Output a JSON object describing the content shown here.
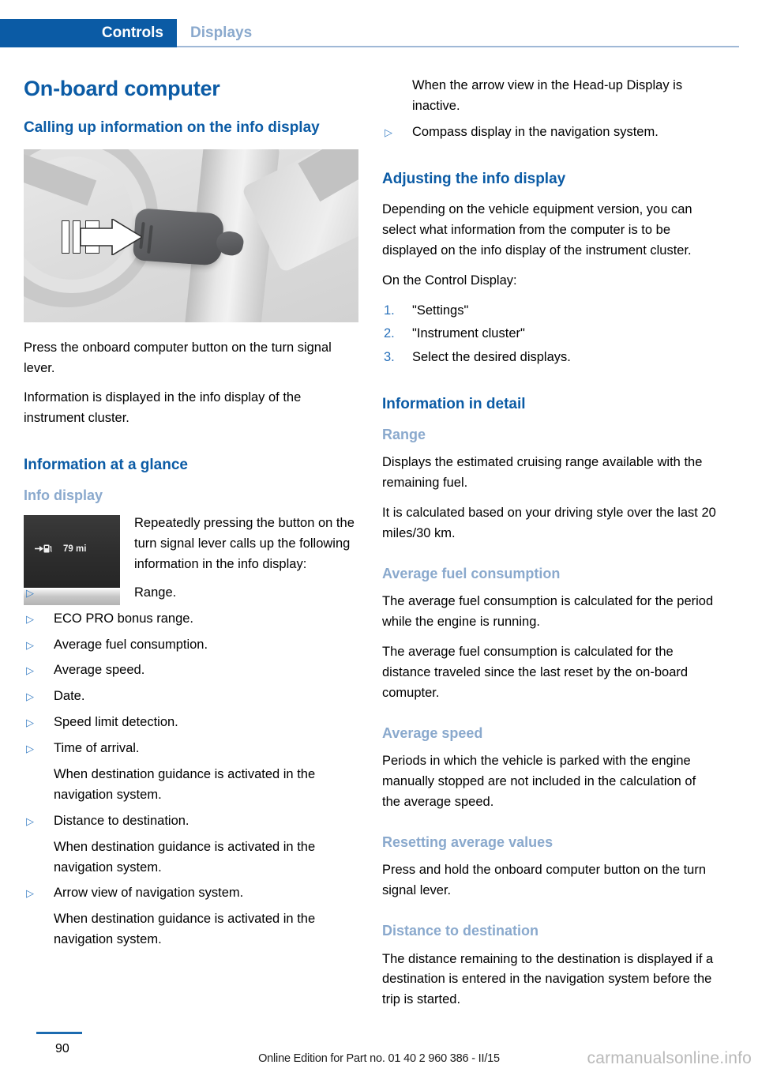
{
  "header": {
    "tab_active": "Controls",
    "tab_inactive": "Displays",
    "accent_color": "#0b5ba5",
    "muted_color": "#8aa9cd"
  },
  "page_title": "On-board computer",
  "left_column": {
    "section1_title": "Calling up information on the info display",
    "figure_lever": {
      "caption_alt": "turn-signal-lever-illustration"
    },
    "para1": "Press the onboard computer button on the turn signal lever.",
    "para2": "Information is displayed in the info display of the instrument cluster.",
    "section2_title": "Information at a glance",
    "sub1_title": "Info display",
    "info_display": {
      "value": "79 mi",
      "icon": "fuel-pump-icon"
    },
    "intro": "Repeatedly pressing the button on the turn signal lever calls up the following information in the info display:",
    "bullets": [
      {
        "marker": "▷",
        "text": "Range.",
        "type": "item"
      },
      {
        "marker": "▷",
        "text": "ECO PRO bonus range.",
        "type": "item"
      },
      {
        "marker": "▷",
        "text": "Average fuel consumption.",
        "type": "item"
      },
      {
        "marker": "▷",
        "text": "Average speed.",
        "type": "item"
      },
      {
        "marker": "▷",
        "text": "Date.",
        "type": "item"
      },
      {
        "marker": "▷",
        "text": "Speed limit detection.",
        "type": "item"
      },
      {
        "marker": "▷",
        "text": "Time of arrival.",
        "type": "item"
      },
      {
        "marker": "",
        "text": "When destination guidance is activated in the navigation system.",
        "type": "cont"
      },
      {
        "marker": "▷",
        "text": "Distance to destination.",
        "type": "item"
      },
      {
        "marker": "",
        "text": "When destination guidance is activated in the navigation system.",
        "type": "cont"
      },
      {
        "marker": "▷",
        "text": "Arrow view of navigation system.",
        "type": "item"
      },
      {
        "marker": "",
        "text": "When destination guidance is activated in the navigation system.",
        "type": "cont"
      }
    ]
  },
  "right_column": {
    "continued_bullets": [
      {
        "marker": "",
        "text": "When the arrow view in the Head-up Display is inactive.",
        "type": "cont"
      },
      {
        "marker": "▷",
        "text": "Compass display in the navigation system.",
        "type": "item"
      }
    ],
    "section1_title": "Adjusting the info display",
    "para1": "Depending on the vehicle equipment version, you can select what information from the computer is to be displayed on the info display of the instrument cluster.",
    "para2": "On the Control Display:",
    "steps": [
      {
        "num": "1.",
        "text": "\"Settings\""
      },
      {
        "num": "2.",
        "text": "\"Instrument cluster\""
      },
      {
        "num": "3.",
        "text": "Select the desired displays."
      }
    ],
    "section2_title": "Information in detail",
    "subsections": [
      {
        "title": "Range",
        "paras": [
          "Displays the estimated cruising range available with the remaining fuel.",
          "It is calculated based on your driving style over the last 20 miles/30 km."
        ]
      },
      {
        "title": "Average fuel consumption",
        "paras": [
          "The average fuel consumption is calculated for the period while the engine is running.",
          "The average fuel consumption is calculated for the distance traveled since the last reset by the on-board comupter."
        ]
      },
      {
        "title": "Average speed",
        "paras": [
          "Periods in which the vehicle is parked with the engine manually stopped are not included in the calculation of the average speed."
        ]
      },
      {
        "title": "Resetting average values",
        "paras": [
          "Press and hold the onboard computer button on the turn signal lever."
        ]
      },
      {
        "title": "Distance to destination",
        "paras": [
          "The distance remaining to the destination is displayed if a destination is entered in the navigation system before the trip is started."
        ]
      }
    ]
  },
  "footer": {
    "page_number": "90",
    "edition_note": "Online Edition for Part no. 01 40 2 960 386 - II/15",
    "watermark": "carmanualsonline.info"
  }
}
